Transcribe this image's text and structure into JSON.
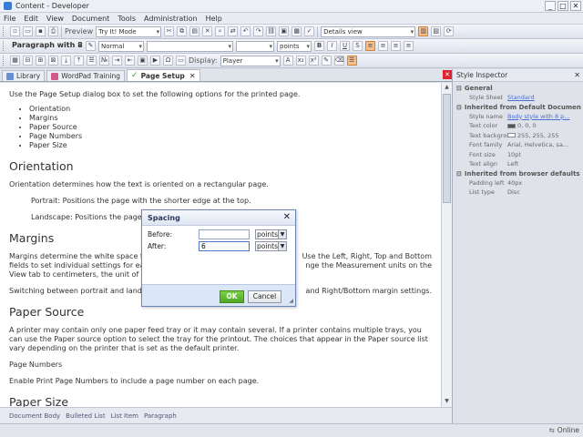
{
  "window": {
    "title": "Content - Developer",
    "controls": [
      "_",
      "□",
      "✕"
    ]
  },
  "menu": [
    "File",
    "Edit",
    "View",
    "Document",
    "Tools",
    "Administration",
    "Help"
  ],
  "toolbar1": {
    "preview_label": "Preview",
    "mode_value": "Try It! Mode",
    "view_value": "Details view"
  },
  "toolbar2": {
    "paragraph_style": "Paragraph with 8 ...",
    "normal_value": "Normal",
    "font_value": "",
    "size_value": "",
    "unit_value": "points"
  },
  "toolbar3": {
    "display_label": "Display:",
    "display_value": "Player"
  },
  "tabs": [
    {
      "label": "Library",
      "color": "#6b8fd4"
    },
    {
      "label": "WordPad Training",
      "color": "#d05a8a"
    },
    {
      "label": "Page Setup",
      "color": "#3aa03a",
      "selected": true
    }
  ],
  "document": {
    "intro": "Use the Page Setup dialog box to set the following options for the printed page.",
    "bullets": [
      "Orientation",
      "Margins",
      "Paper Source",
      "Page Numbers",
      "Paper Size"
    ],
    "orientation_heading": "Orientation",
    "orientation_text": "Orientation determines how the text is oriented on a rectangular page.",
    "portrait_text": "Portrait: Positions the page with the shorter edge at the top.",
    "landscape_text": "Landscape: Positions the page w",
    "margins_heading": "Margins",
    "margins_text_1": "Margins determine the white space from",
    "margins_text_1b": "Use the Left, Right, Top and Bottom",
    "margins_text_2": "fields to set individual settings for each",
    "margins_text_2b": "nge the Measurement units on the",
    "margins_text_3": "View tab to centimeters, the unit of mar",
    "switching_text": "Switching between portrait and landsca",
    "switching_text_b": "and Right/Bottom margin settings.",
    "paper_source_heading": "Paper Source",
    "paper_source_text": "A printer may contain only one paper feed tray or it may contain several. If a printer contains multiple trays, you can use the Paper source option to select the tray for the printout. The choices that appear in the Paper source list vary depending on the printer that is set as the default printer.",
    "page_numbers_label": "Page Numbers",
    "page_numbers_text": "Enable Print Page Numbers to include a page number on each page.",
    "paper_size_heading": "Paper Size"
  },
  "doc_status": [
    "Document Body",
    "Bulleted List",
    "List Item",
    "Paragraph"
  ],
  "inspector": {
    "title": "Style Inspector",
    "groups": [
      {
        "name": "General",
        "rows": [
          {
            "k": "Style Sheet",
            "v": "Standard",
            "link": true
          }
        ]
      },
      {
        "name": "Inherited from Default Document Body",
        "rows": [
          {
            "k": "Style name",
            "v": "Body style with 8 p...",
            "link": true
          },
          {
            "k": "Text color",
            "v": "0, 0, 0",
            "swatch": "#555555"
          },
          {
            "k": "Text background c",
            "v": "255, 255, 255",
            "swatch": "#ffffff"
          },
          {
            "k": "Font family",
            "v": "Arial, Helvetica, sa..."
          },
          {
            "k": "Font size",
            "v": "10pt"
          },
          {
            "k": "Text align",
            "v": "Left"
          }
        ]
      },
      {
        "name": "Inherited from browser defaults",
        "rows": [
          {
            "k": "Padding left",
            "v": "40px"
          },
          {
            "k": "List type",
            "v": "Disc"
          }
        ]
      }
    ]
  },
  "statusbar": {
    "online_label": "Online"
  },
  "dialog": {
    "title": "Spacing",
    "before_label": "Before:",
    "before_value": "",
    "before_unit": "points",
    "after_label": "After:",
    "after_value": "6",
    "after_unit": "points",
    "ok_label": "OK",
    "cancel_label": "Cancel"
  }
}
